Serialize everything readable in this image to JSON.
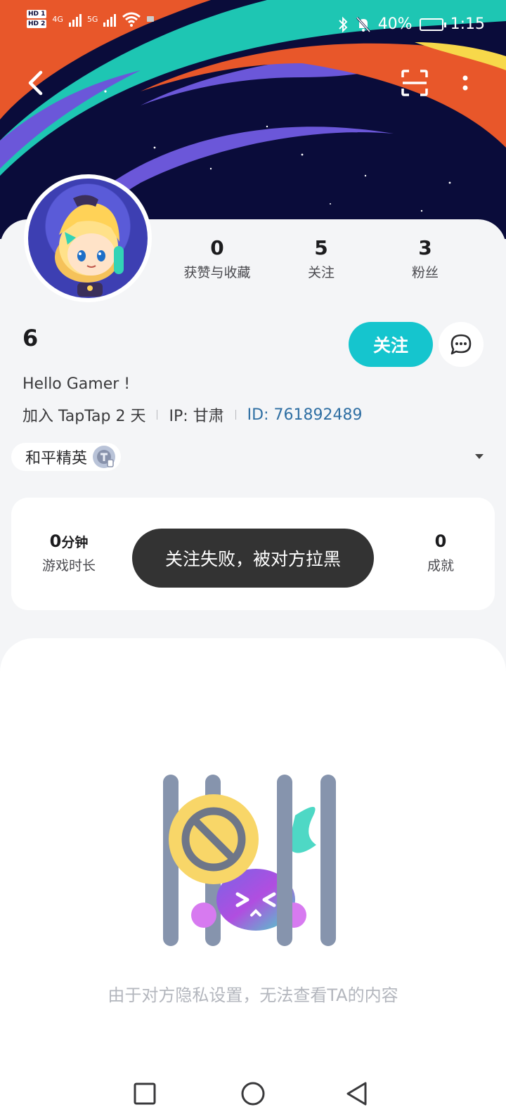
{
  "status_bar": {
    "hd1": "HD 1",
    "hd2": "HD 2",
    "net1": "4G",
    "net2": "5G",
    "battery": "40%",
    "time": "1:15"
  },
  "stats": [
    {
      "value": "0",
      "label": "获赞与收藏"
    },
    {
      "value": "5",
      "label": "关注"
    },
    {
      "value": "3",
      "label": "粉丝"
    }
  ],
  "user": {
    "name": "6",
    "bio": "Hello Gamer !",
    "joined": "加入 TapTap 2 天",
    "ip": "IP: 甘肃",
    "id": "ID: 761892489"
  },
  "actions": {
    "follow_label": "关注"
  },
  "game_tag": {
    "label": "和平精英"
  },
  "game_stats": {
    "playtime_value": "0",
    "playtime_unit": "分钟",
    "playtime_label": "游戏时长",
    "achievements_value": "0",
    "achievements_label": "成就"
  },
  "toast": {
    "message": "关注失败，被对方拉黑"
  },
  "empty_state": {
    "message": "由于对方隐私设置，无法查看TA的内容"
  },
  "colors": {
    "accent": "#15c5ce",
    "id_link": "#2f6fa3",
    "toast_bg": "#333333"
  }
}
